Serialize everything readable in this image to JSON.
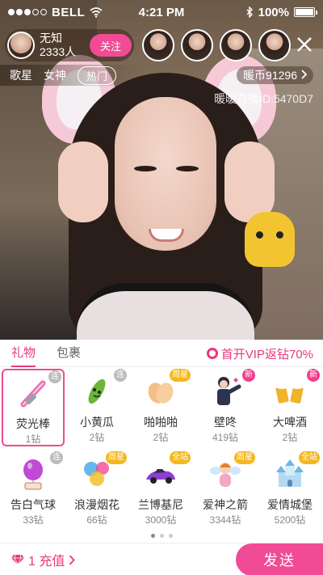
{
  "status_bar": {
    "carrier": "BELL",
    "time": "4:21 PM",
    "battery": "100%",
    "signal_bars_filled": 3,
    "signal_bars_total": 5
  },
  "host": {
    "name": "无知",
    "viewer_count": "2333人",
    "follow_label": "关注"
  },
  "tags": {
    "tag1": "歌星",
    "tag2": "女神",
    "hot": "热门"
  },
  "coins": "暖币91296",
  "room_id": "暖暖直播ID:5470D7",
  "panel": {
    "tabs": [
      "礼物",
      "包裹"
    ],
    "vip_text": "首开VIP返钻70%"
  },
  "gifts": [
    {
      "name": "荧光棒",
      "price": "1钻",
      "badge": "连",
      "badge_type": "lian",
      "icon": "glowstick-icon",
      "selected": true
    },
    {
      "name": "小黄瓜",
      "price": "2钻",
      "badge": "连",
      "badge_type": "lian",
      "icon": "cucumber-icon",
      "selected": false
    },
    {
      "name": "啪啪啪",
      "price": "2钻",
      "badge": "周星",
      "badge_type": "star",
      "icon": "clapping-hands-icon",
      "selected": false
    },
    {
      "name": "壁咚",
      "price": "419钻",
      "badge": "新",
      "badge_type": "new",
      "icon": "kabedon-man-icon",
      "selected": false
    },
    {
      "name": "大啤酒",
      "price": "2钻",
      "badge": "新",
      "badge_type": "new",
      "icon": "beer-mugs-icon",
      "selected": false
    },
    {
      "name": "告白气球",
      "price": "33钻",
      "badge": "连",
      "badge_type": "lian",
      "icon": "love-balloon-icon",
      "selected": false
    },
    {
      "name": "浪漫烟花",
      "price": "66钻",
      "badge": "周星",
      "badge_type": "star",
      "icon": "fireworks-icon",
      "selected": false
    },
    {
      "name": "兰博基尼",
      "price": "3000钻",
      "badge": "全站",
      "badge_type": "star",
      "icon": "sports-car-icon",
      "selected": false
    },
    {
      "name": "爱神之箭",
      "price": "3344钻",
      "badge": "周星",
      "badge_type": "star",
      "icon": "cupid-icon",
      "selected": false
    },
    {
      "name": "爱情城堡",
      "price": "5200钻",
      "badge": "全站",
      "badge_type": "star",
      "icon": "castle-icon",
      "selected": false
    }
  ],
  "pagination": {
    "pages": 3,
    "current": 1
  },
  "bottom": {
    "recharge_label": "1 充值",
    "send_label": "发送"
  },
  "colors": {
    "accent": "#f04b94",
    "accent_text": "#e8397d",
    "badge_star": "#f5b720",
    "badge_new": "#ee3e8a"
  }
}
